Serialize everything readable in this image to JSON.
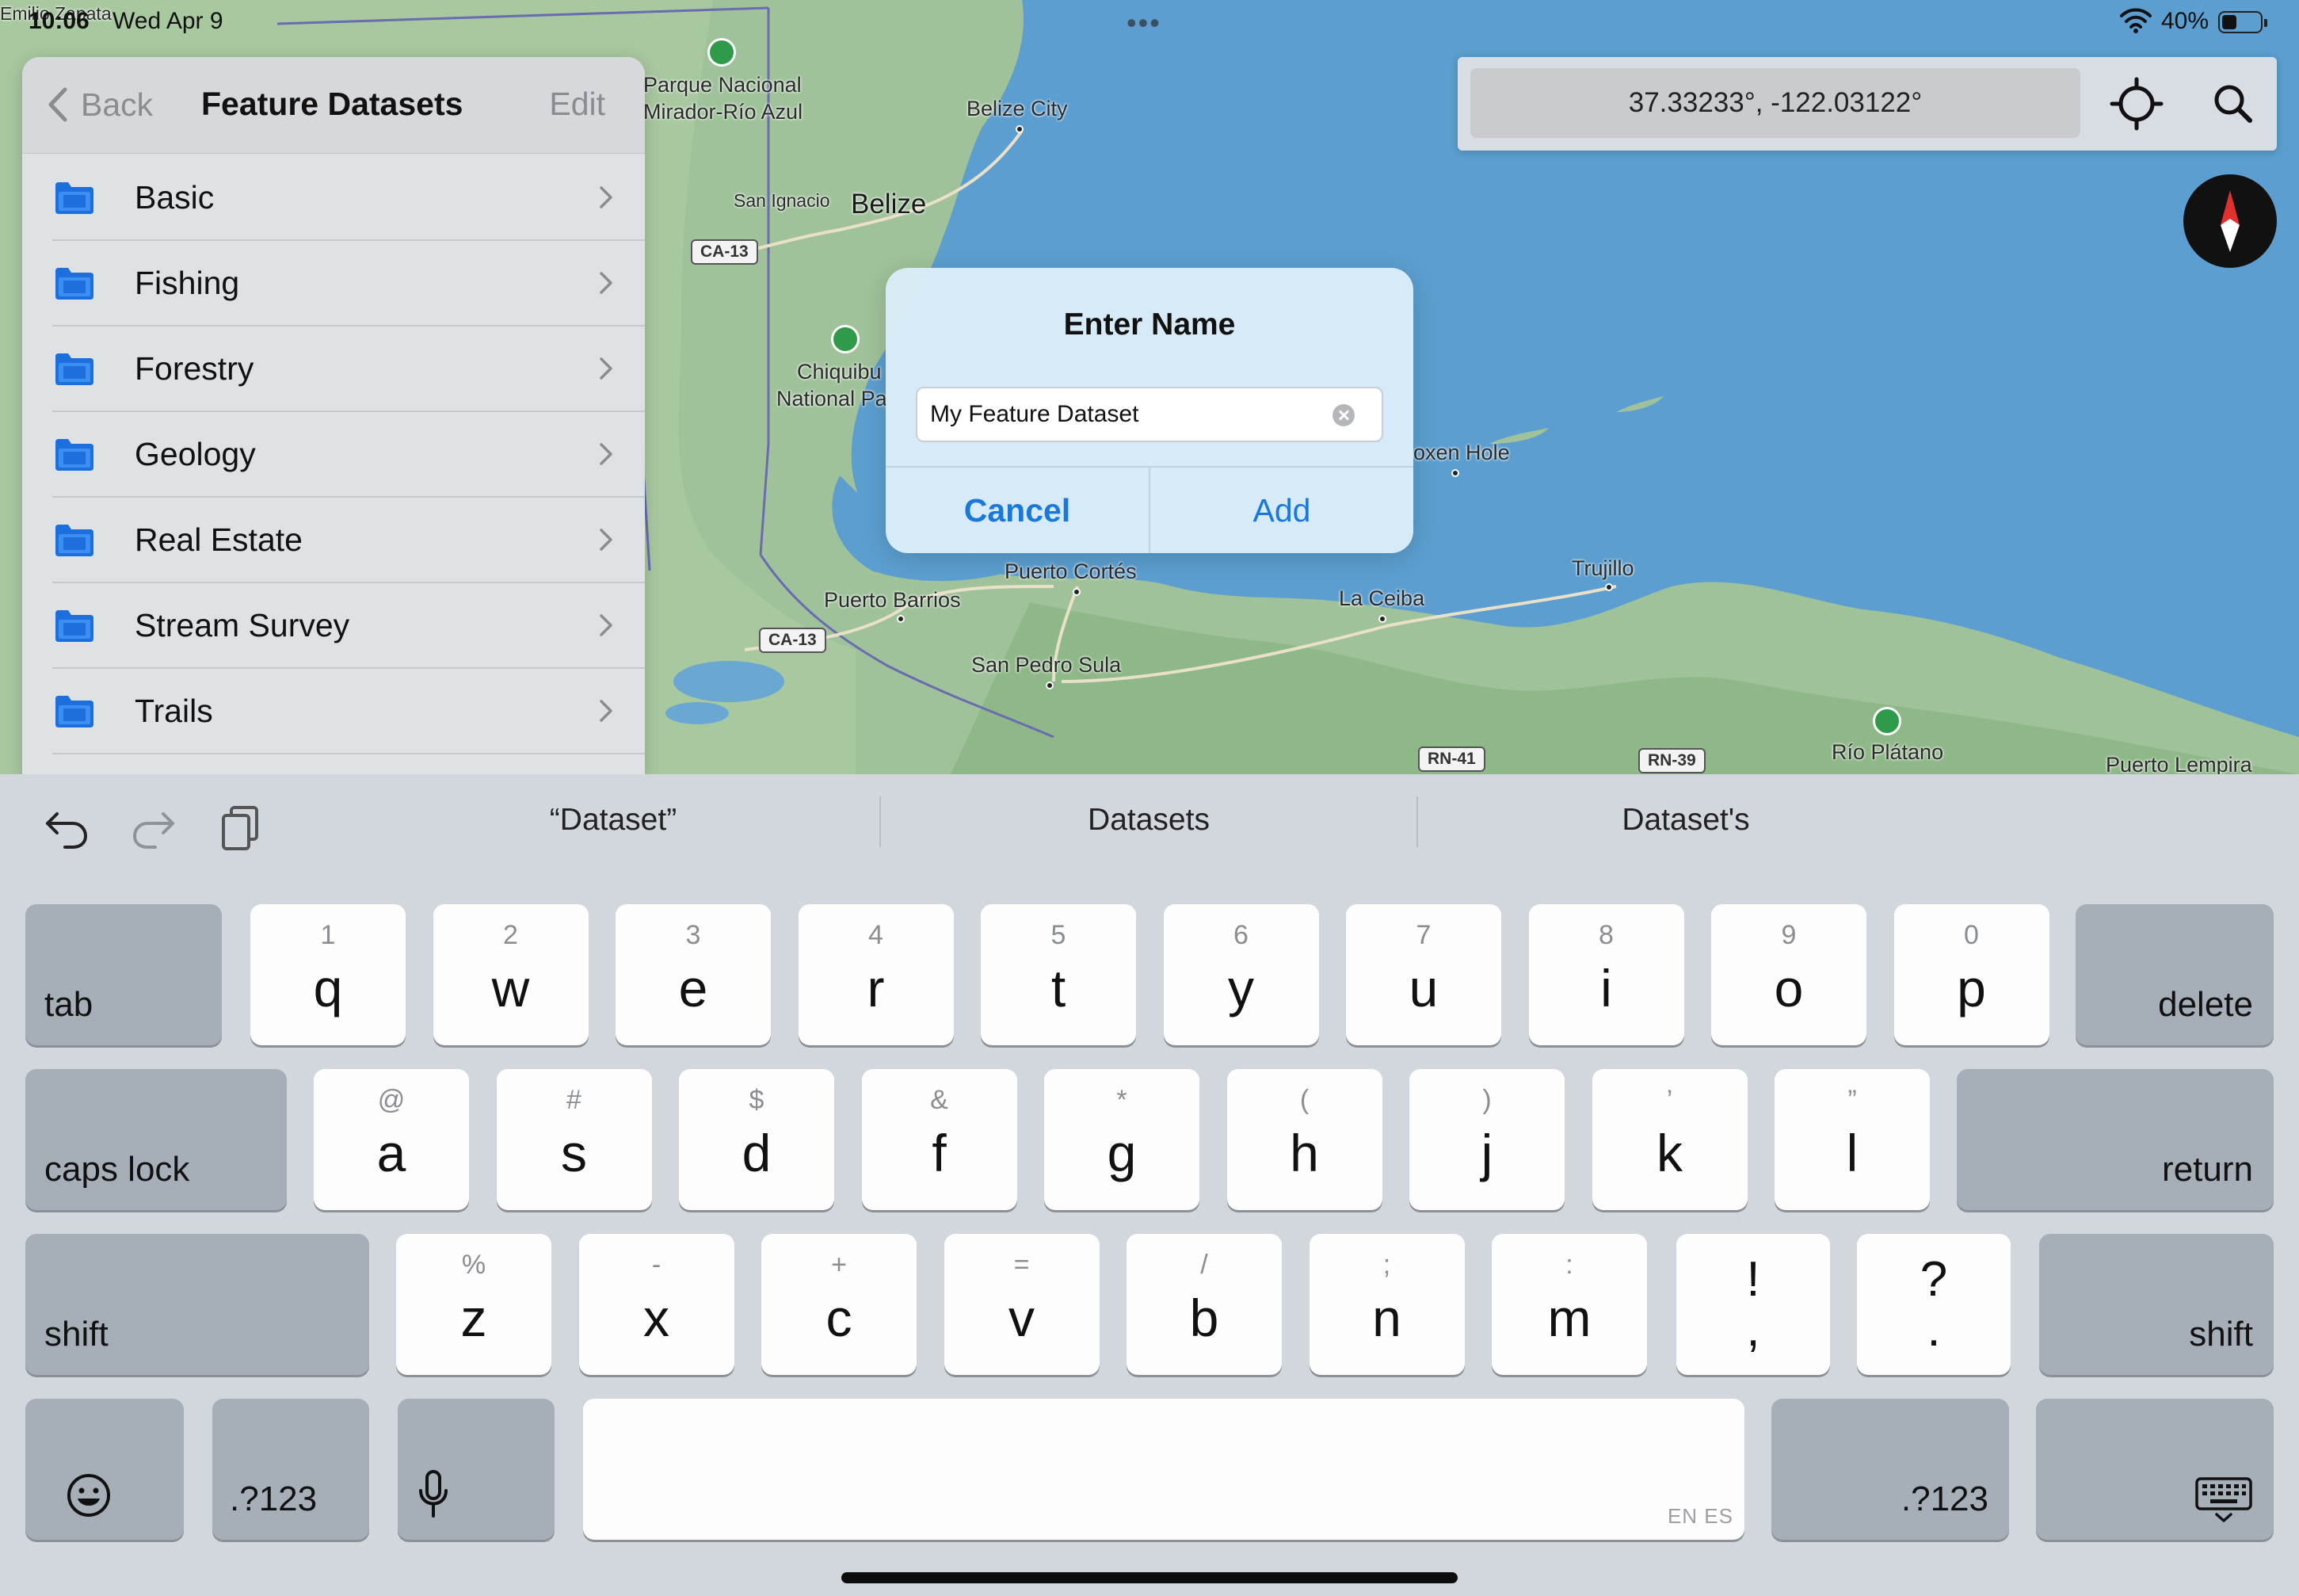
{
  "status_bar": {
    "time": "10:06",
    "date": "Wed Apr 9",
    "battery_text": "40%",
    "battery_level": 0.4
  },
  "map": {
    "labels": {
      "parque_nacional_1": "Parque Nacional",
      "parque_nacional_2": "Mirador-Río Azul",
      "belize_city": "Belize City",
      "san_ignacio": "San Ignacio",
      "belize": "Belize",
      "chiquibul_1": "Chiquibu",
      "chiquibul_2": "National Pa",
      "oxen_hole": "oxen Hole",
      "trujillo": "Trujillo",
      "puerto_cortes": "Puerto Cortés",
      "puerto_barrios": "Puerto Barrios",
      "la_ceiba": "La Ceiba",
      "san_pedro_sula": "San Pedro Sula",
      "rio_platano": "Río Plátano",
      "puerto_lempira": "Puerto Lempira",
      "emilio_zapata": "Emilio Zapata"
    },
    "roads": {
      "ca13_north": "CA-13",
      "ca13_south": "CA-13",
      "rn41": "RN-41",
      "rn39": "RN-39"
    }
  },
  "panel": {
    "back_label": "Back",
    "title": "Feature Datasets",
    "edit_label": "Edit",
    "items": [
      {
        "label": "Basic",
        "icon": "folder-icon"
      },
      {
        "label": "Fishing",
        "icon": "folder-icon"
      },
      {
        "label": "Forestry",
        "icon": "folder-icon"
      },
      {
        "label": "Geology",
        "icon": "folder-icon"
      },
      {
        "label": "Real Estate",
        "icon": "folder-icon"
      },
      {
        "label": "Stream Survey",
        "icon": "folder-icon"
      },
      {
        "label": "Trails",
        "icon": "folder-icon"
      }
    ]
  },
  "coord_bar": {
    "coordinates": "37.33233°, -122.03122°",
    "locate_icon": "crosshair-icon",
    "search_icon": "search-icon"
  },
  "dialog": {
    "title": "Enter Name",
    "input_value": "My Feature Dataset",
    "cancel_label": "Cancel",
    "add_label": "Add"
  },
  "keyboard": {
    "suggestions": [
      "“Dataset”",
      "Datasets",
      "Dataset's"
    ],
    "row1": {
      "tab": "tab",
      "keys": [
        {
          "main": "q",
          "hint": "1"
        },
        {
          "main": "w",
          "hint": "2"
        },
        {
          "main": "e",
          "hint": "3"
        },
        {
          "main": "r",
          "hint": "4"
        },
        {
          "main": "t",
          "hint": "5"
        },
        {
          "main": "y",
          "hint": "6"
        },
        {
          "main": "u",
          "hint": "7"
        },
        {
          "main": "i",
          "hint": "8"
        },
        {
          "main": "o",
          "hint": "9"
        },
        {
          "main": "p",
          "hint": "0"
        }
      ],
      "delete": "delete"
    },
    "row2": {
      "caps": "caps lock",
      "keys": [
        {
          "main": "a",
          "hint": "@"
        },
        {
          "main": "s",
          "hint": "#"
        },
        {
          "main": "d",
          "hint": "$"
        },
        {
          "main": "f",
          "hint": "&"
        },
        {
          "main": "g",
          "hint": "*"
        },
        {
          "main": "h",
          "hint": "("
        },
        {
          "main": "j",
          "hint": ")"
        },
        {
          "main": "k",
          "hint": "’"
        },
        {
          "main": "l",
          "hint": "”"
        }
      ],
      "return": "return"
    },
    "row3": {
      "shift_left": "shift",
      "keys": [
        {
          "main": "z",
          "hint": "%"
        },
        {
          "main": "x",
          "hint": "-"
        },
        {
          "main": "c",
          "hint": "+"
        },
        {
          "main": "v",
          "hint": "="
        },
        {
          "main": "b",
          "hint": "/"
        },
        {
          "main": "n",
          "hint": ";"
        },
        {
          "main": "m",
          "hint": ":"
        }
      ],
      "punct": [
        {
          "top": "!",
          "bottom": ","
        },
        {
          "top": "?",
          "bottom": "."
        }
      ],
      "shift_right": "shift"
    },
    "row4": {
      "numbers_left": ".?123",
      "numbers_right": ".?123",
      "space_language": "EN ES"
    }
  }
}
